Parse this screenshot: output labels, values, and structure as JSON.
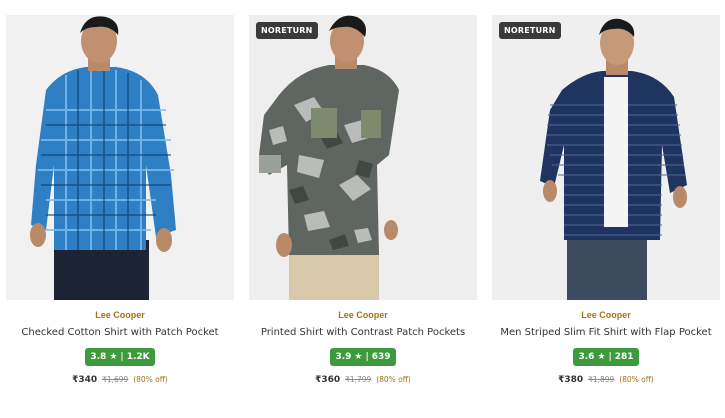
{
  "products": [
    {
      "badge": "",
      "brand": "Lee Cooper",
      "title": "Checked Cotton Shirt with Patch Pocket",
      "rating": "3.8",
      "rating_icon": "star-icon",
      "rating_count": "1.2K",
      "price": "₹340",
      "mrp": "₹1,699",
      "discount": "(80% off)",
      "shirt_color": "#2e7fc4"
    },
    {
      "badge": "NORETURN",
      "brand": "Lee Cooper",
      "title": "Printed Shirt with Contrast Patch Pockets",
      "rating": "3.9",
      "rating_icon": "star-icon",
      "rating_count": "639",
      "price": "₹360",
      "mrp": "₹1,799",
      "discount": "(80% off)",
      "shirt_color": "#5f6561"
    },
    {
      "badge": "NORETURN",
      "brand": "Lee Cooper",
      "title": "Men Striped Slim Fit Shirt with Flap Pocket",
      "rating": "3.6",
      "rating_icon": "star-icon",
      "rating_count": "281",
      "price": "₹380",
      "mrp": "₹1,899",
      "discount": "(80% off)",
      "shirt_color": "#1f3560"
    }
  ],
  "colors": {
    "brand": "#a0731f",
    "rating_bg": "#3d9b3d",
    "badge_bg": "#3a3a3a"
  },
  "rating_star": "★"
}
